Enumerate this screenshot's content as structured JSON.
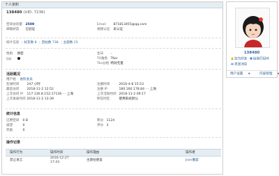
{
  "header": {
    "title": "个人资料"
  },
  "user": {
    "name": "138480",
    "uid": "(UID: 7236)"
  },
  "info": [
    {
      "label": "空间访问量",
      "value": "2509"
    },
    {
      "label": "邮箱状态",
      "value": "已验证"
    },
    {
      "label": "Email",
      "value": "871813455@qq.com"
    },
    {
      "label": "视频认证",
      "value": "未认证"
    }
  ],
  "stats": {
    "prefix": "统计信息",
    "friends": "好友数 8",
    "replies": "回帖数 738",
    "threads": "主题数 15"
  },
  "profile": {
    "gender_label": "性别",
    "gender_value": "保密",
    "qq_label": "QQ",
    "birthday_label": "生日",
    "birthday_value": "-",
    "tx_label": "TX角色",
    "tx_value": "TKer",
    "role_label": "Tks分组",
    "role_value": "特效无量"
  },
  "active": {
    "title": "活跃概况",
    "rows": [
      {
        "label": "用户组",
        "value": "进阶会员"
      },
      {
        "label": "在线时间",
        "value": "247 小时"
      },
      {
        "label": "注册时间",
        "value": "2016-4-8 15:53"
      },
      {
        "label": "最后访问",
        "value": "2018-11-2 12:52"
      },
      {
        "label": "注册 IP",
        "value": "180.160.178.84 - - 上海"
      },
      {
        "label": "上次访问 IP",
        "value": "117.136.8.152:17136 - - 上海"
      },
      {
        "label": "上次活动时间",
        "value": "2018-11-2 09:17"
      },
      {
        "label": "上次发表时间",
        "value": "2018-11-2 13:39"
      },
      {
        "label": "所在时区",
        "value": "使用系统默认"
      }
    ]
  },
  "statistics": {
    "title": "统计信息",
    "rows": [
      {
        "label": "已用空间",
        "value": "0 B"
      },
      {
        "label": "积分",
        "value": "1124"
      },
      {
        "label": "威望",
        "value": "0"
      },
      {
        "label": "评分",
        "value": "3"
      },
      {
        "label": "奖励",
        "value": "0"
      }
    ]
  },
  "oplog": {
    "title": "操作记录",
    "columns": [
      "操作行为",
      "操作时间",
      "操作理由",
      "操作者"
    ],
    "rows": [
      {
        "action": "禁止发言",
        "time": "2016-12-27 17:43",
        "reason": "主题帖重复",
        "operator": "Json魔宴"
      }
    ]
  },
  "sidebar": {
    "name": "138480",
    "actions": [
      "加为好友",
      "给我打招呼",
      "发送消息"
    ],
    "menu": [
      "用户设置",
      "内容管理"
    ]
  }
}
